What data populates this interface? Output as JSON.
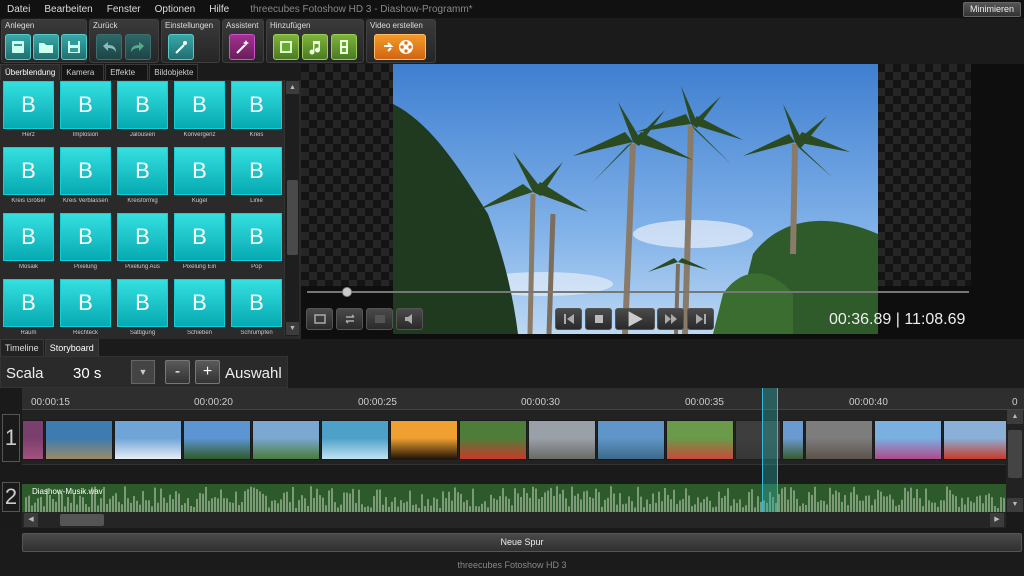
{
  "menu": {
    "items": [
      "Datei",
      "Bearbeiten",
      "Fenster",
      "Optionen",
      "Hilfe"
    ],
    "app_title": "threecubes Fotoshow HD 3 - Diashow-Programm*",
    "minimize_label": "Minimieren"
  },
  "toolbar": {
    "groups": {
      "anlegen": "Anlegen",
      "zurueck": "Zurück",
      "einstellungen": "Einstellungen",
      "assistent": "Assistent",
      "hinzufuegen": "Hinzufügen",
      "video": "Video erstellen"
    }
  },
  "effect_tabs": [
    "Überblendung",
    "Kamera",
    "Effekte",
    "Bildobjekte"
  ],
  "effects": {
    "thumb_letter": "B",
    "items": [
      "Herz",
      "Implosion",
      "Jalousien",
      "Konvergenz",
      "Kreis",
      "Kreis Größer",
      "Kreis Verblassen",
      "Kreisförmig",
      "Kugel",
      "Linie",
      "Mosaik",
      "Pixelung",
      "Pixelung Aus",
      "Pixelung Ein",
      "Pop",
      "Raum",
      "Rechteck",
      "Sättigung",
      "Schieben",
      "Schrumpfen"
    ]
  },
  "preview": {
    "timecode": "00:36.89 | 11:08.69",
    "progress": 0.06
  },
  "bottom_tabs": [
    "Timeline",
    "Storyboard"
  ],
  "scale": {
    "label": "Scala",
    "value": "30 s",
    "dropdown_icon": "▼",
    "minus": "-",
    "plus": "+",
    "selection": "Auswahl"
  },
  "timeline": {
    "ruler_labels": [
      "00:00:15",
      "00:00:20",
      "00:00:25",
      "00:00:30",
      "00:00:35",
      "00:00:40",
      "0"
    ],
    "track_numbers": [
      "1",
      "2"
    ],
    "audio_label": "Diashow-Musik.wav",
    "new_track": "Neue Spur"
  },
  "footer": "threecubes Fotoshow HD 3",
  "colors": {
    "accent_teal": "#2bc6c9",
    "effect_thumb": "#1ac8cf",
    "audio_track": "#2d5a2a",
    "video_button": "#f08a22"
  }
}
